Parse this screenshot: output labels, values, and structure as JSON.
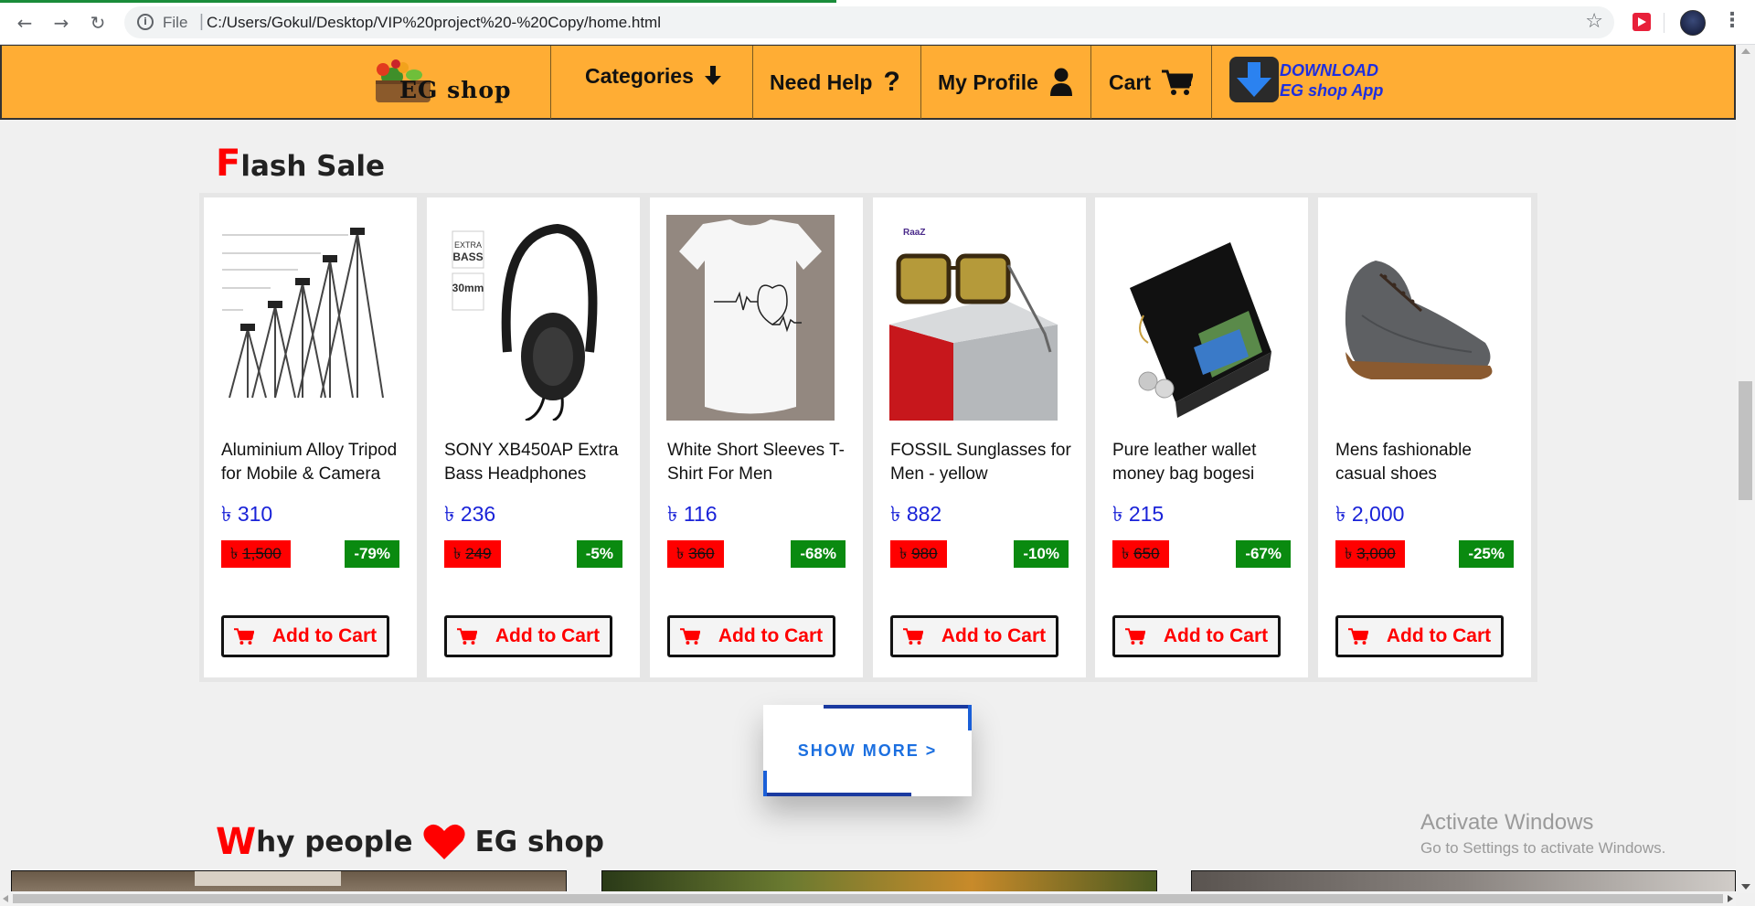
{
  "browser": {
    "file_label": "File",
    "url": "C:/Users/Gokul/Desktop/VIP%20project%20-%20Copy/home.html"
  },
  "header": {
    "logo_text": "EG shop",
    "nav": {
      "categories": "Categories",
      "help": "Need Help",
      "profile": "My Profile",
      "cart": "Cart"
    },
    "download_line1": "DOWNLOAD",
    "download_line2": "EG shop App"
  },
  "flash_sale": {
    "title_first": "F",
    "title_rest": "lash Sale",
    "add_to_cart_label": "Add to Cart",
    "products": [
      {
        "name": "Aluminium Alloy Tripod for Mobile & Camera",
        "price": "৳ 310",
        "old_price": "1,500",
        "discount": "-79%"
      },
      {
        "name": "SONY XB450AP Extra Bass Headphones",
        "price": "৳ 236",
        "old_price": "249",
        "discount": "-5%"
      },
      {
        "name": "White Short Sleeves T-Shirt For Men",
        "price": "৳ 116",
        "old_price": "360",
        "discount": "-68%"
      },
      {
        "name": "FOSSIL Sunglasses for Men - yellow",
        "price": "৳ 882",
        "old_price": "980",
        "discount": "-10%"
      },
      {
        "name": "Pure leather wallet money bag bogesi",
        "price": "৳ 215",
        "old_price": "650",
        "discount": "-67%"
      },
      {
        "name": "Mens fashionable casual shoes",
        "price": "৳ 2,000",
        "old_price": "3,000",
        "discount": "-25%"
      }
    ],
    "currency_symbol": "৳"
  },
  "show_more_label": "SHOW MORE >",
  "why_section": {
    "title_first": "W",
    "title_middle": "hy people",
    "title_end": "EG shop"
  },
  "windows_notice": {
    "line1": "Activate Windows",
    "line2": "Go to Settings to activate Windows."
  },
  "colors": {
    "header_bg": "#ffad34",
    "accent_red": "#ff0000",
    "price_blue": "#1a23d8",
    "discount_green": "#0a8a10",
    "show_more_blue": "#1b6fe0"
  }
}
